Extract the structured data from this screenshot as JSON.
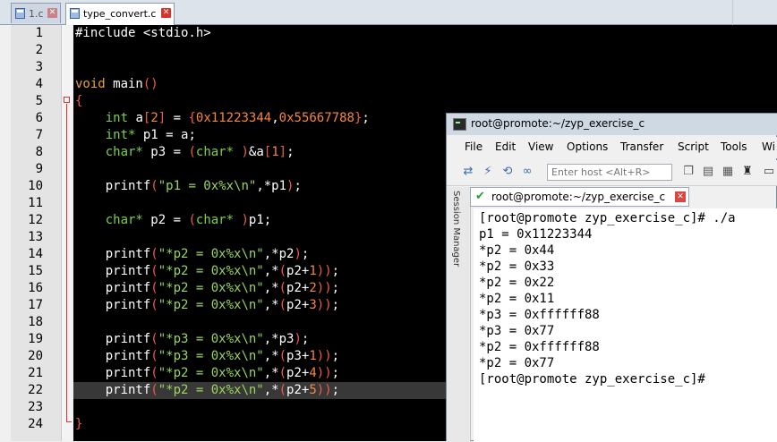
{
  "editor": {
    "tabs": [
      {
        "label": "1.c"
      },
      {
        "label": "type_convert.c"
      }
    ],
    "line_numbers": [
      "1",
      "2",
      "3",
      "4",
      "5",
      "6",
      "7",
      "8",
      "9",
      "10",
      "11",
      "12",
      "13",
      "14",
      "15",
      "16",
      "17",
      "18",
      "19",
      "20",
      "21",
      "22",
      "23",
      "24"
    ]
  },
  "terminal": {
    "title": "root@promote:~/zyp_exercise_c",
    "menu": [
      "File",
      "Edit",
      "View",
      "Options",
      "Transfer",
      "Script",
      "Tools",
      "Wi"
    ],
    "host_placeholder": "Enter host <Alt+R>",
    "session_manager_label": "Session Manager",
    "session_tab_label": "root@promote:~/zyp_exercise_c",
    "output_lines": [
      "[root@promote zyp_exercise_c]# ./a",
      "p1 = 0x11223344",
      "*p2 = 0x44",
      "*p2 = 0x33",
      "*p2 = 0x22",
      "*p2 = 0x11",
      "*p3 = 0xffffff88",
      "*p3 = 0x77",
      "*p2 = 0xffffff88",
      "*p2 = 0x77",
      "[root@promote zyp_exercise_c]#"
    ]
  },
  "colors": {
    "keyword": "#e8a33a",
    "type": "#7bd24a",
    "string": "#9bd55c",
    "number": "#f6883c",
    "paren": "#f15c4a",
    "editor_bg": "#000000"
  }
}
